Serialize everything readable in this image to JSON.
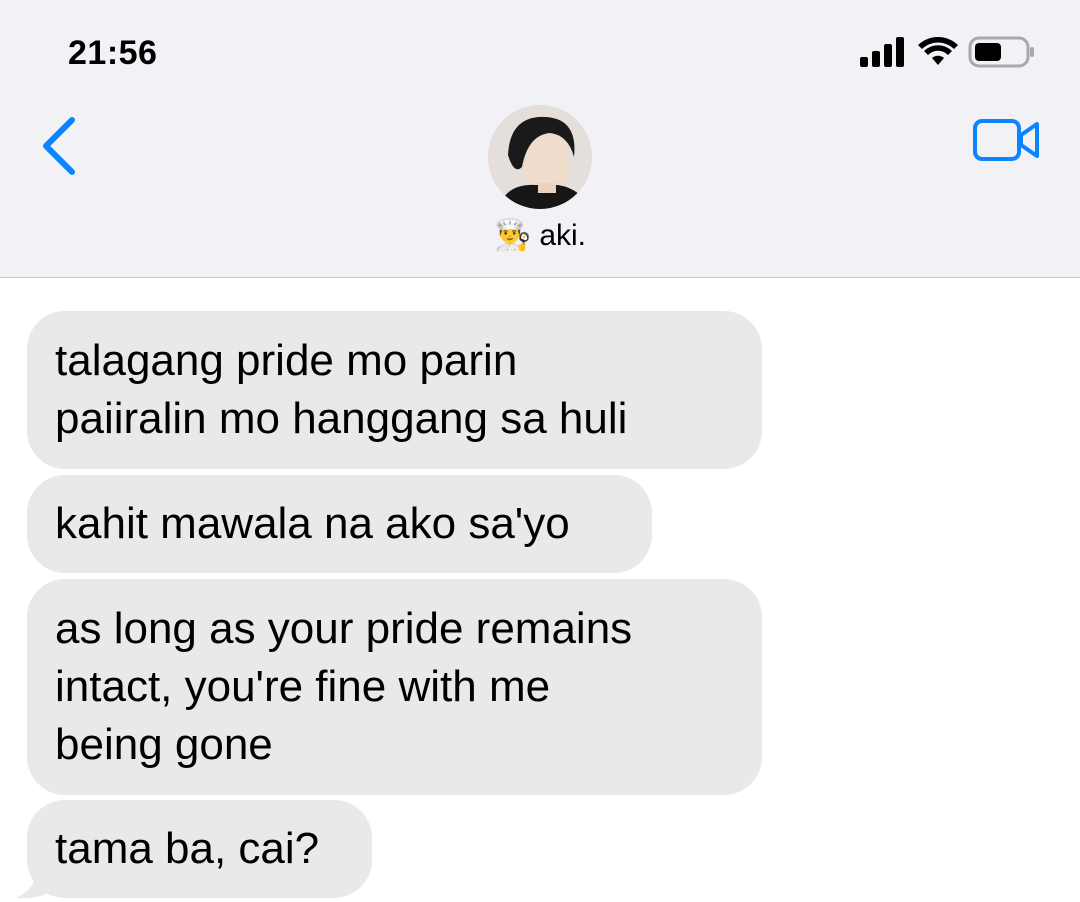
{
  "status_bar": {
    "time": "21:56",
    "icons": [
      "signal-icon",
      "wifi-icon",
      "battery-icon"
    ]
  },
  "header": {
    "back_icon": "chevron-left-icon",
    "video_icon": "video-camera-icon",
    "contact": {
      "emoji": "👨‍🍳",
      "name": "aki."
    }
  },
  "messages": [
    {
      "lines": [
        "talagang pride mo parin",
        "paiiralin mo hanggang sa huli"
      ]
    },
    {
      "lines": [
        "kahit mawala na ako sa'yo"
      ]
    },
    {
      "lines": [
        "as long as your pride remains",
        "intact, you're fine with me",
        "being gone"
      ]
    },
    {
      "lines": [
        "tama ba, cai?"
      ]
    }
  ],
  "colors": {
    "accent": "#0a84ff",
    "bubble_received": "#e9e9eb",
    "header_bg": "#f1f1f6"
  }
}
